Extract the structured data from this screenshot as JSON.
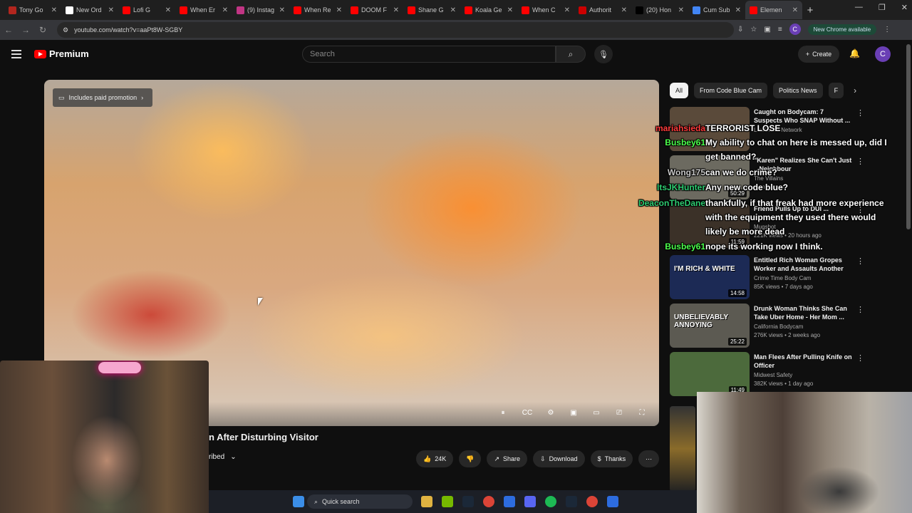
{
  "browser": {
    "tabs": [
      {
        "label": "Tony Go",
        "color": "#b3261e"
      },
      {
        "label": "New Ord",
        "color": "#ffffff"
      },
      {
        "label": "Lofi G",
        "color": "#ff0000"
      },
      {
        "label": "When Er",
        "color": "#ff0000"
      },
      {
        "label": "(9) Instag",
        "color": "#c13584"
      },
      {
        "label": "When Re",
        "color": "#ff0000"
      },
      {
        "label": "DOOM F",
        "color": "#ff0000"
      },
      {
        "label": "Shane G",
        "color": "#ff0000"
      },
      {
        "label": "Koala Ge",
        "color": "#ff0000"
      },
      {
        "label": "When C",
        "color": "#ff0000"
      },
      {
        "label": "Authorit",
        "color": "#cc0000"
      },
      {
        "label": "(20) Hon",
        "color": "#000000"
      },
      {
        "label": "Cum Sub",
        "color": "#4285f4"
      },
      {
        "label": "Elemen",
        "color": "#ff0000"
      }
    ],
    "url": "youtube.com/watch?v=aaPt8W-SGBY",
    "profile_initial": "C",
    "new_chrome_label": "New Chrome available"
  },
  "youtube": {
    "logo_text": "Premium",
    "search_placeholder": "Search",
    "create_label": "Create",
    "avatar_initial": "C",
    "promo_label": "Includes paid promotion",
    "video_title": "n After Disturbing Visitor",
    "subscribed_label": "ribed",
    "likes": "24K",
    "share_label": "Share",
    "download_label": "Download",
    "thanks_label": "Thanks",
    "chips": [
      "All",
      "From Code Blue Cam",
      "Politics News",
      "F"
    ],
    "recommendations": [
      {
        "title": "Caught on Bodycam: 7 Suspects Who SNAP Without ...",
        "channel": "LawCrime Network",
        "meta": "",
        "duration": "",
        "thumb_text": "",
        "thumb_color": "#5a4a3a"
      },
      {
        "title": "\"Karen\" Realizes She Can't Just ...Neighbour",
        "channel": "The Villains",
        "meta": "months ago",
        "duration": "50:29",
        "thumb_text": "",
        "thumb_color": "#6c6a60"
      },
      {
        "title": "Friend Pulls Up to DUI ...",
        "channel": "Mugshot",
        "meta": "221K views • 20 hours ago",
        "duration": "11:59",
        "thumb_text": "",
        "thumb_color": "#3b3128"
      },
      {
        "title": "Entitled Rich Woman Gropes Worker and Assaults Another",
        "channel": "Crime Time Body Cam",
        "meta": "85K views • 7 days ago",
        "duration": "14:58",
        "thumb_text": "I'M RICH & WHITE",
        "thumb_color": "#1c2a55"
      },
      {
        "title": "Drunk Woman Thinks She Can Take Uber Home - Her Mom ...",
        "channel": "California Bodycam",
        "meta": "276K views • 2 weeks ago",
        "duration": "25:22",
        "thumb_text": "UNBELIEVABLY ANNOYING",
        "thumb_color": "#5c5a52"
      },
      {
        "title": "Man Flees After Pulling Knife on Officer",
        "channel": "Midwest Safety",
        "meta": "382K views • 1 day ago",
        "duration": "11:49",
        "thumb_text": "",
        "thumb_color": "#4c6a3c"
      }
    ]
  },
  "chat": [
    {
      "user": "mariahsieda",
      "user_color": "#ff3b3b",
      "text": "TERRORIST LOSE"
    },
    {
      "user": "Busbey61",
      "user_color": "#4cff4c",
      "text": "My ability to chat on here is messed up, did I get banned?"
    },
    {
      "user": "Wong175",
      "user_color": "#c8c8c8",
      "text": "can we do crime?"
    },
    {
      "user": "ItsJKHunter",
      "user_color": "#2ecc71",
      "text": "Any new code blue?"
    },
    {
      "user": "DeaconTheDane",
      "user_color": "#2ecc71",
      "text": "thankfully, if that freak had more experience with the equipment they used there would likely be more dead"
    },
    {
      "user": "Busbey61",
      "user_color": "#4cff4c",
      "text": "nope its working now I think."
    }
  ],
  "taskbar": {
    "search_label": "Quick search"
  }
}
